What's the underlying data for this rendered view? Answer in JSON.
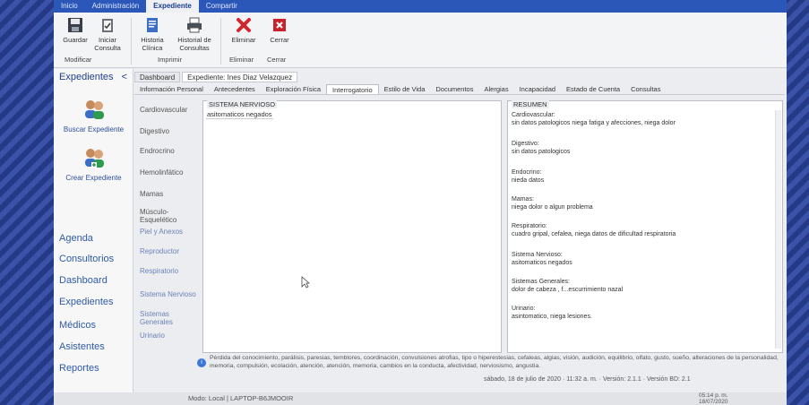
{
  "ribbon_tabs": [
    "Inicio",
    "Administración",
    "Expediente",
    "Compartir"
  ],
  "ribbon": {
    "modify_group": "Modificar",
    "print_group": "Imprimir",
    "delete_group": "Eliminar",
    "close_group": "Cerrar",
    "save": "Guardar",
    "start_consult": "Iniciar Consulta",
    "clinical_history": "Historia Clínica",
    "consult_history": "Historial de Consultas",
    "delete": "Eliminar",
    "close": "Cerrar"
  },
  "leftnav": {
    "title": "Expedientes",
    "collapse": "<",
    "search": "Buscar Expediente",
    "create": "Crear Expediente",
    "items": [
      "Agenda",
      "Consultorios",
      "Dashboard",
      "Expedientes",
      "Médicos",
      "Asistentes",
      "Reportes"
    ]
  },
  "doctabs": [
    "Dashboard",
    "Expediente: Ines Diaz Velazquez"
  ],
  "subtabs": [
    "Información Personal",
    "Antecedentes",
    "Exploración Física",
    "Interrogatorio",
    "Estilo de Vida",
    "Documentos",
    "Alergias",
    "Incapacidad",
    "Estado de Cuenta",
    "Consultas"
  ],
  "systems": [
    "Cardiovascular",
    "Digestivo",
    "Endrocrino",
    "Hemolinfático",
    "Mamas",
    "Músculo-Esquelético",
    "Piel y Anexos",
    "Reproductor",
    "Respiratorio",
    "Sistema Nervioso",
    "Sistemas Generales",
    "Urinario"
  ],
  "editor": {
    "title": "SISTEMA NERVIOSO",
    "value": "asitomaticos negados"
  },
  "resumen": {
    "title": "RESUMEN",
    "entries": [
      {
        "label": "Cardiovascular:",
        "text": "sin datos patologicos niega fatiga y afecciones, niega dolor"
      },
      {
        "label": "Digestivo:",
        "text": "sin datos patologicos"
      },
      {
        "label": "Endocrino:",
        "text": "nieda datos"
      },
      {
        "label": "Mamas:",
        "text": "niega dolor o algun problema"
      },
      {
        "label": "Respiratorio:",
        "text": "cuadro gripal, cefalea, niega datos de dificultad respiratoria"
      },
      {
        "label": "Sistema Nervioso:",
        "text": "asitomaticos negados"
      },
      {
        "label": "Sistemas Generales:",
        "text": "dolor de cabeza , f...escurrimiento nazal"
      },
      {
        "label": "Urinario:",
        "text": "asintomatico, niega lesiones."
      }
    ]
  },
  "info": {
    "text": "Pérdida del conocimiento, parálisis, paresias, temblores, coordinación, convulsiones atrofias, tipo o hiperestesias, cefaleas, algias, visión, audición, equilibrio, olfato, gusto, sueño, alteraciones de la personalidad, memoria, compulsión, ecolación, atención, atención, memoria, cambios en la conducta, afectividad, nerviosismo, angustia."
  },
  "status": {
    "mode": "Modo: Local | LAPTOP-B6JMOOIR",
    "datetime": "sábado, 18 de julio de 2020 · 11:32 a. m. · Versión: 2.1.1 · Versión BD: 2.1",
    "clock": "05:14 p. m.",
    "date": "18/07/2020"
  }
}
